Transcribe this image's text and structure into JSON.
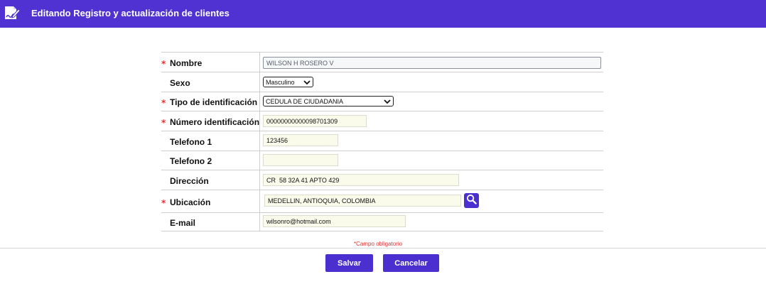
{
  "header": {
    "title": "Editando Registro y actualización de clientes",
    "logo_icon": "edit-signature-icon",
    "background": "#5032d2"
  },
  "form": {
    "required_marker": "*",
    "fields": [
      {
        "key": "nombre",
        "label": "Nombre",
        "required": true,
        "type": "text",
        "value": "WILSON H ROSERO V"
      },
      {
        "key": "sexo",
        "label": "Sexo",
        "required": false,
        "type": "select",
        "value": "Masculino"
      },
      {
        "key": "tipo_identificacion",
        "label": "Tipo de identificación",
        "required": true,
        "type": "select",
        "value": "CEDULA DE CIUDADANIA"
      },
      {
        "key": "numero_identificacion",
        "label": "Número identificación",
        "required": true,
        "type": "text",
        "value": "00000000000098701309"
      },
      {
        "key": "telefono1",
        "label": "Telefono 1",
        "required": false,
        "type": "text",
        "value": "123456"
      },
      {
        "key": "telefono2",
        "label": "Telefono 2",
        "required": false,
        "type": "text",
        "value": ""
      },
      {
        "key": "direccion",
        "label": "Dirección",
        "required": false,
        "type": "text",
        "value": "CR  58 32A 41 APTO 429"
      },
      {
        "key": "ubicacion",
        "label": "Ubicación",
        "required": true,
        "type": "text",
        "value": "MEDELLIN, ANTIOQUIA, COLOMBIA",
        "action_icon": "search-icon"
      },
      {
        "key": "email",
        "label": "E-mail",
        "required": false,
        "type": "text",
        "value": "wilsonro@hotmail.com"
      }
    ]
  },
  "required_note": {
    "marker": "*",
    "text": "Campo obligatorio"
  },
  "actions": {
    "save_label": "Salvar",
    "cancel_label": "Cancelar",
    "accent": "#4b2fcf"
  }
}
